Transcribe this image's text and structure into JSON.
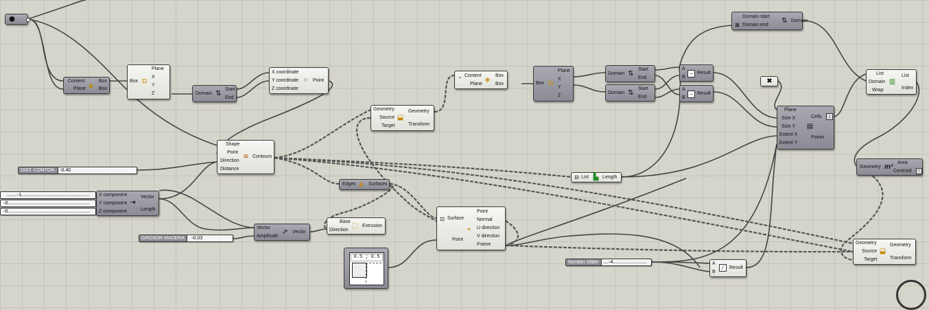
{
  "components": {
    "deconstruct_box_a": {
      "in1": "Content",
      "in2": "Plane",
      "out1": "Box",
      "out2": "Box"
    },
    "box_a": {
      "in1": "Box",
      "out1": "Plane",
      "out2": "X",
      "out3": "Y",
      "out4": "Z"
    },
    "domain_a": {
      "in1": "Domain",
      "out1": "Start",
      "out2": "End"
    },
    "construct_point": {
      "in1": "X coordinate",
      "in2": "Y coordinate",
      "in3": "Z coordinate",
      "out1": "Point"
    },
    "contours": {
      "in1": "Shape",
      "in2": "Point",
      "in3": "Direction",
      "in4": "Distance",
      "out1": "Contours"
    },
    "orient_a": {
      "in1": "Geometry",
      "in2": "Source",
      "in3": "Target",
      "out1": "Geometry",
      "out2": "Transform"
    },
    "deconstruct_box_b": {
      "in1": "Content",
      "in2": "Plane",
      "out1": "Box",
      "out2": "Box"
    },
    "box_b": {
      "in1": "Box",
      "out1": "Plane",
      "out2": "X",
      "out3": "Y",
      "out4": "Z"
    },
    "domain_b": {
      "in1": "Domain",
      "out1": "Start",
      "out2": "End"
    },
    "domain_c": {
      "in1": "Domain",
      "out1": "Start",
      "out2": "End"
    },
    "sub_a": {
      "in1": "A",
      "in2": "B",
      "out1": "Result"
    },
    "sub_b": {
      "in1": "A",
      "in2": "B",
      "out1": "Result"
    },
    "construct_domain": {
      "in1": "Domain start",
      "in2": "Domain end",
      "out1": "Domain"
    },
    "list_item": {
      "in1": "List",
      "in2": "Domain",
      "in3": "Wrap",
      "out1": "List",
      "out2": "Index"
    },
    "rect_grid": {
      "in1": "Plane",
      "in2": "Size X",
      "in3": "Size Y",
      "in4": "Extent X",
      "in5": "Extent Y",
      "out1": "Cells",
      "out2": "Points"
    },
    "area": {
      "in1": "Geometry",
      "out1": "Area",
      "out2": "Centroid"
    },
    "list_length": {
      "in1": "List",
      "out1": "Length"
    },
    "edges_surfaces": {
      "in1": "Edges",
      "out1": "Surfaces"
    },
    "vector_xyz": {
      "in1": "X component",
      "in2": "Y component",
      "in3": "Z component",
      "out1": "Vector",
      "out2": "Length"
    },
    "amplitude": {
      "in1": "Vector",
      "in2": "Amplitude",
      "out1": "Vector"
    },
    "extrusion": {
      "in1": "Base",
      "in2": "Direction",
      "out1": "Extrusion"
    },
    "eval_surface": {
      "in1": "Surface",
      "in2": "Point",
      "out1": "Point",
      "out2": "Normal",
      "out3": "U direction",
      "out4": "V direction",
      "out5": "Frame"
    },
    "division": {
      "in1": "A",
      "in2": "B",
      "out1": "Result"
    },
    "orient_b": {
      "in1": "Geometry",
      "in2": "Source",
      "in3": "Target",
      "out1": "Geometry",
      "out2": "Transform"
    }
  },
  "sliders": {
    "dist_contor": {
      "label": "DIST. CONTOR.",
      "value": "0.40"
    },
    "x_slider": {
      "label": "",
      "value": "1"
    },
    "y_slider": {
      "label": "",
      "value": "0"
    },
    "z_slider": {
      "label": "",
      "value": "0"
    },
    "grosor": {
      "label": "GROSOR MADERA",
      "value": "0.03"
    },
    "number_slider": {
      "label": "Number Slider",
      "value": "4"
    }
  },
  "md_slider": {
    "value": "0.5 ; 0.5"
  }
}
